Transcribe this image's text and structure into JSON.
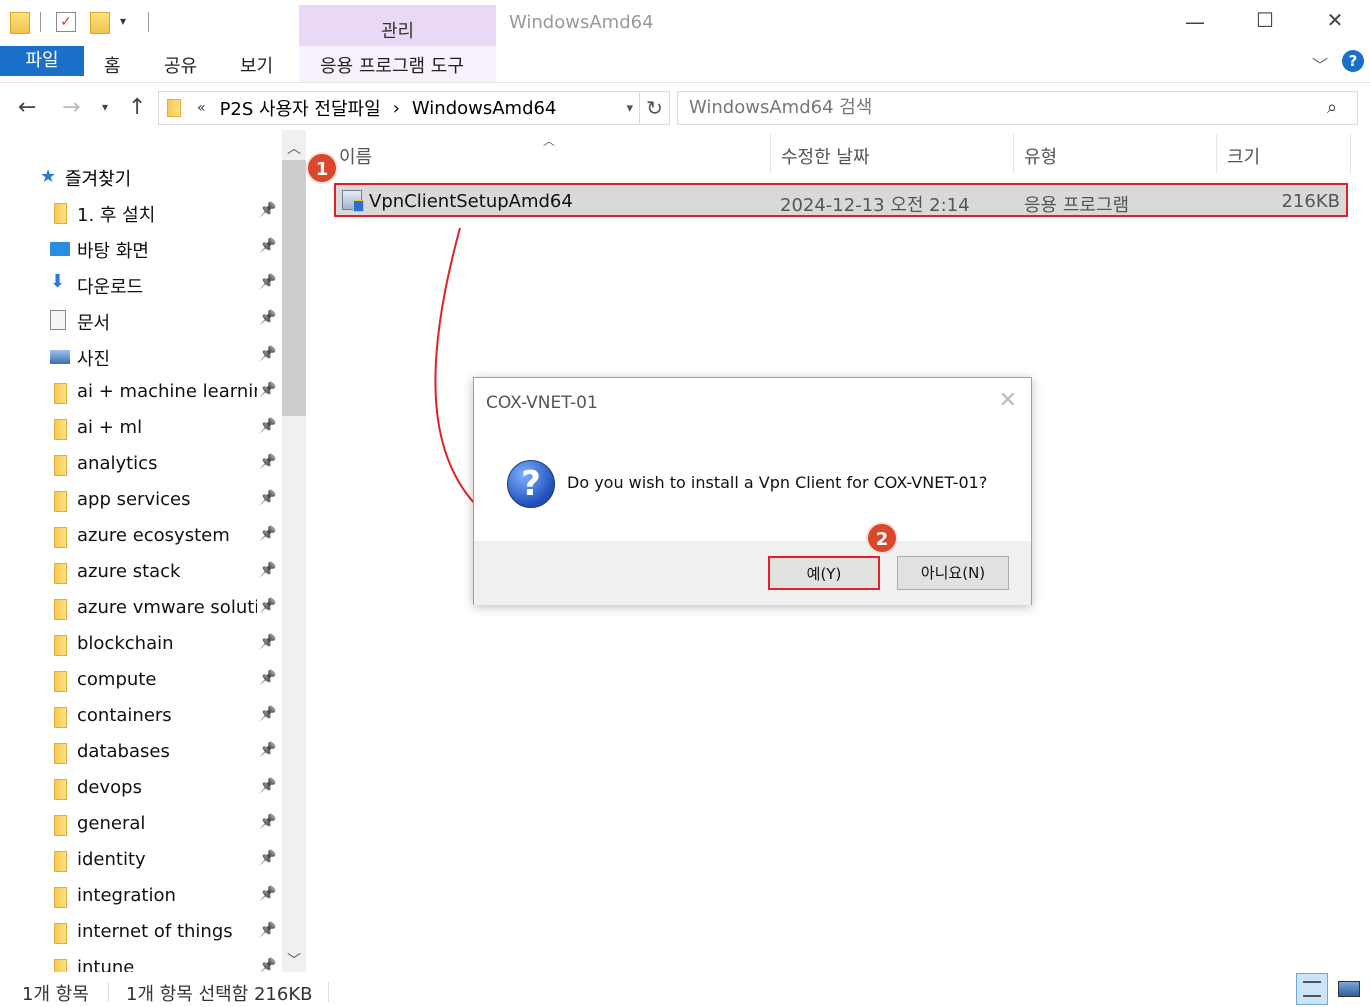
{
  "window": {
    "title": "WindowsAmd64",
    "contextual_tab": "관리",
    "contextual_group": "응용 프로그램 도구"
  },
  "ribbon": {
    "tabs": [
      "파일",
      "홈",
      "공유",
      "보기"
    ]
  },
  "address": {
    "overflow": "«",
    "crumbs": [
      "P2S 사용자 전달파일",
      "WindowsAmd64"
    ],
    "separator": "›"
  },
  "search": {
    "placeholder": "WindowsAmd64 검색"
  },
  "nav": {
    "quick_access": "즐겨찾기",
    "items": [
      {
        "label": "1. 후 설치",
        "icon": "folder-icon"
      },
      {
        "label": "바탕 화면",
        "icon": "desktop-icon"
      },
      {
        "label": "다운로드",
        "icon": "download-icon"
      },
      {
        "label": "문서",
        "icon": "document-icon"
      },
      {
        "label": "사진",
        "icon": "pictures-icon"
      },
      {
        "label": "ai + machine learning",
        "icon": "folder-icon"
      },
      {
        "label": "ai + ml",
        "icon": "folder-icon"
      },
      {
        "label": "analytics",
        "icon": "folder-icon"
      },
      {
        "label": "app services",
        "icon": "folder-icon"
      },
      {
        "label": "azure ecosystem",
        "icon": "folder-icon"
      },
      {
        "label": "azure stack",
        "icon": "folder-icon"
      },
      {
        "label": "azure vmware solution",
        "icon": "folder-icon"
      },
      {
        "label": "blockchain",
        "icon": "folder-icon"
      },
      {
        "label": "compute",
        "icon": "folder-icon"
      },
      {
        "label": "containers",
        "icon": "folder-icon"
      },
      {
        "label": "databases",
        "icon": "folder-icon"
      },
      {
        "label": "devops",
        "icon": "folder-icon"
      },
      {
        "label": "general",
        "icon": "folder-icon"
      },
      {
        "label": "identity",
        "icon": "folder-icon"
      },
      {
        "label": "integration",
        "icon": "folder-icon"
      },
      {
        "label": "internet of things",
        "icon": "folder-icon"
      },
      {
        "label": "intune",
        "icon": "folder-icon"
      }
    ]
  },
  "list": {
    "columns": [
      "이름",
      "수정한 날짜",
      "유형",
      "크기"
    ],
    "rows": [
      {
        "name": "VpnClientSetupAmd64",
        "date": "2024-12-13 오전 2:14",
        "type": "응용 프로그램",
        "size": "216KB"
      }
    ]
  },
  "dialog": {
    "title": "COX-VNET-01",
    "message": "Do you wish to install a Vpn Client for COX-VNET-01?",
    "yes": "예(Y)",
    "no": "아니요(N)"
  },
  "annotations": {
    "step1": "1",
    "step2": "2",
    "color": "#e0202a"
  },
  "status": {
    "count": "1개 항목",
    "selected": "1개 항목 선택함 216KB"
  }
}
